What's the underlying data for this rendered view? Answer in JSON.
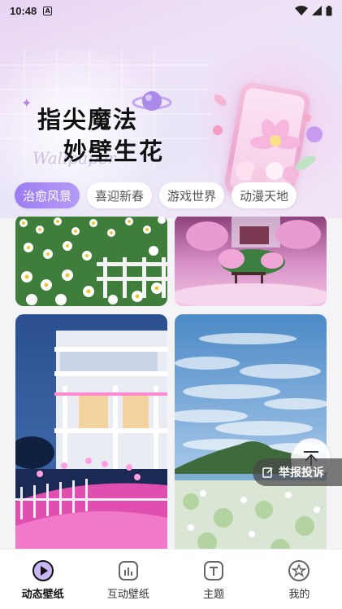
{
  "status_bar": {
    "time": "10:48",
    "notification_icon": "A"
  },
  "hero": {
    "title_line1": "指尖魔法",
    "title_line2": "妙壁生花",
    "script_text": "Wallpaper"
  },
  "tabs": [
    {
      "label": "治愈风景",
      "active": true
    },
    {
      "label": "喜迎新春",
      "active": false
    },
    {
      "label": "游戏世界",
      "active": false
    },
    {
      "label": "动漫天地",
      "active": false
    }
  ],
  "feed": {
    "cards": [
      {
        "name": "daisy-field-wallpaper"
      },
      {
        "name": "pink-fairy-island-wallpaper"
      },
      {
        "name": "pink-villa-night-wallpaper"
      },
      {
        "name": "cloud-sky-island-wallpaper"
      }
    ]
  },
  "report_button": {
    "label": "举报投诉"
  },
  "bottom_nav": [
    {
      "label": "动态壁纸",
      "icon": "play-icon",
      "active": true
    },
    {
      "label": "互动壁纸",
      "icon": "chart-icon",
      "active": false
    },
    {
      "label": "主题",
      "icon": "theme-t-icon",
      "active": false
    },
    {
      "label": "我的",
      "icon": "star-profile-icon",
      "active": false
    }
  ],
  "colors": {
    "accent_purple": "#9c7cf2",
    "hero_pink": "#e7d4f3"
  }
}
